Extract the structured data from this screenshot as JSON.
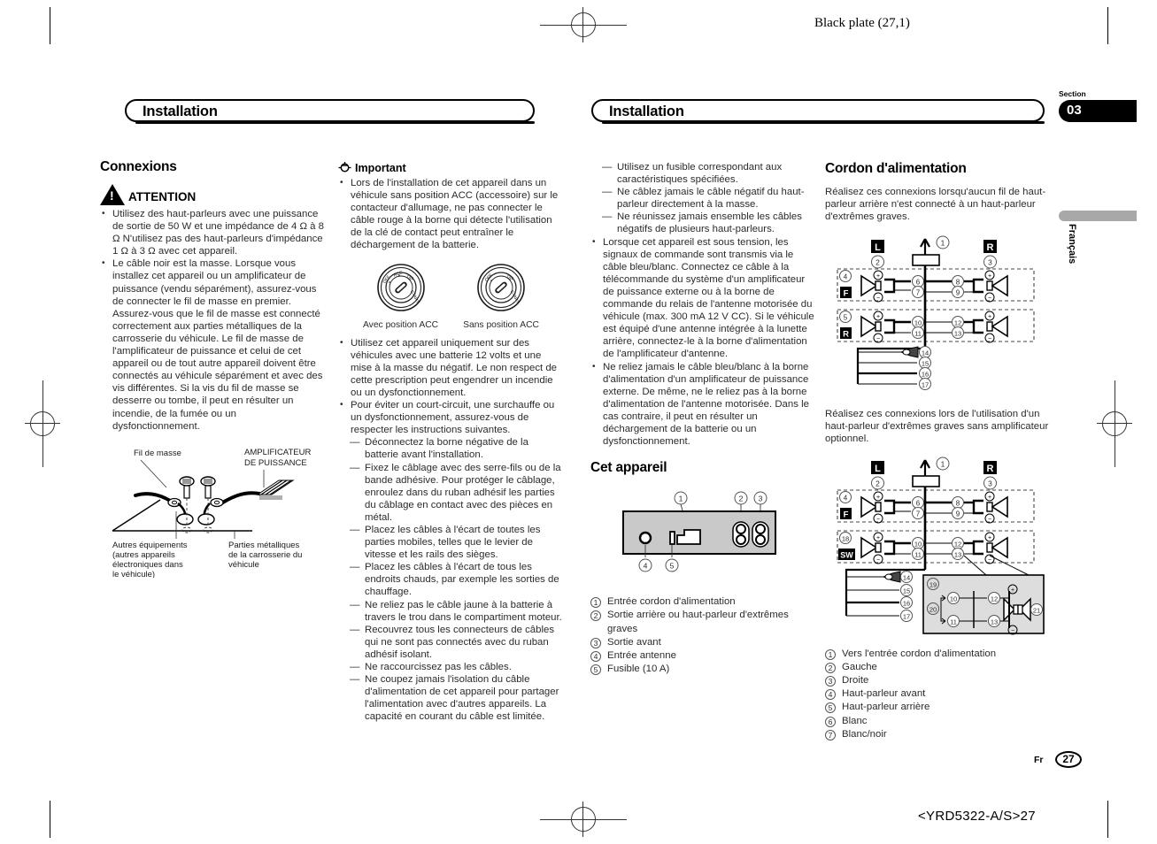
{
  "page": {
    "black_plate": "Black plate (27,1)",
    "section_label": "Section",
    "section_number": "03",
    "language_tab": "Français",
    "footer_lang": "Fr",
    "footer_page": "27",
    "footer_code": "<YRD5322-A/S>27"
  },
  "header": {
    "left_title": "Installation",
    "right_title": "Installation"
  },
  "col1": {
    "heading": "Connexions",
    "caution_word": "ATTENTION",
    "caution_items": [
      "Utilisez des haut-parleurs avec une puissance de sortie de 50 W et une impédance de 4 Ω à 8 Ω N'utilisez pas des haut-parleurs d'impédance 1 Ω à 3 Ω avec cet appareil.",
      "Le câble noir est la masse. Lorsque vous installez cet appareil ou un amplificateur de puissance (vendu séparément), assurez-vous de connecter le fil de masse en premier. Assurez-vous que le fil de masse est connecté correctement aux parties métalliques de la carrosserie du véhicule. Le fil de masse de l'amplificateur de puissance et celui de cet appareil ou de tout autre appareil doivent être connectés au véhicule séparément et avec des vis différentes. Si la vis du fil de masse se desserre ou tombe, il peut en résulter un incendie, de la fumée ou un dysfonctionnement."
    ],
    "figure_labels": {
      "ground_wire": "Fil de masse",
      "amplifier": "AMPLIFICATEUR DE PUISSANCE",
      "other_equipment": "Autres équipements (autres appareils électroniques dans le véhicule)",
      "metal_body": "Parties métalliques de la carrosserie du véhicule"
    }
  },
  "col2": {
    "important_word": "Important",
    "important_items": [
      "Lors de l'installation de cet appareil dans un véhicule sans position ACC (accessoire) sur le contacteur d'allumage, ne pas connecter le câble rouge à la borne qui détecte l'utilisation de la clé de contact peut entraîner le déchargement de la batterie."
    ],
    "key_figures": [
      {
        "caption": "Avec position ACC"
      },
      {
        "caption": "Sans position ACC"
      }
    ],
    "items": [
      "Utilisez cet appareil uniquement sur des véhicules avec une batterie 12 volts et une mise à la masse du négatif. Le non respect de cette prescription peut engendrer un incendie ou un dysfonctionnement.",
      "Pour éviter un court-circuit, une surchauffe ou un dysfonctionnement, assurez-vous de respecter les instructions suivantes."
    ],
    "sub_items": [
      "Déconnectez la borne négative de la batterie avant l'installation.",
      "Fixez le câblage avec des serre-fils ou de la bande adhésive. Pour protéger le câblage, enroulez dans du ruban adhésif les parties du câblage en contact avec des pièces en métal.",
      "Placez les câbles à l'écart de toutes les parties mobiles, telles que le levier de vitesse et les rails des sièges.",
      "Placez les câbles à l'écart de tous les endroits chauds, par exemple les sorties de chauffage.",
      "Ne reliez pas le câble jaune à la batterie à travers le trou dans le compartiment moteur.",
      "Recouvrez tous les connecteurs de câbles qui ne sont pas connectés avec du ruban adhésif isolant.",
      "Ne raccourcissez pas les câbles.",
      "Ne coupez jamais l'isolation du câble d'alimentation de cet appareil pour partager l'alimentation avec d'autres appareils. La capacité en courant du câble est limitée."
    ]
  },
  "col3": {
    "sub_items_top": [
      "Utilisez un fusible correspondant aux caractéristiques spécifiées.",
      "Ne câblez jamais le câble négatif du haut-parleur directement à la masse.",
      "Ne réunissez jamais ensemble les câbles négatifs de plusieurs haut-parleurs."
    ],
    "items": [
      "Lorsque cet appareil est sous tension, les signaux de commande sont transmis via le câble bleu/blanc. Connectez ce câble à la télécommande du système d'un amplificateur de puissance externe ou à la borne de commande du relais de l'antenne motorisée du véhicule (max. 300 mA 12 V CC). Si le véhicule est équipé d'une antenne intégrée à la lunette arrière, connectez-le à la borne d'alimentation de l'amplificateur d'antenne.",
      "Ne reliez jamais le câble bleu/blanc à la borne d'alimentation d'un amplificateur de puissance externe. De même, ne le reliez pas à la borne d'alimentation de l'antenne motorisée. Dans le cas contraire, il peut en résulter un déchargement de la batterie ou un dysfonctionnement."
    ],
    "unit_heading": "Cet appareil",
    "unit_callouts": [
      "1",
      "2",
      "3",
      "4",
      "5"
    ],
    "legend": [
      "Entrée cordon d'alimentation",
      "Sortie arrière ou haut-parleur d'extrêmes graves",
      "Sortie avant",
      "Entrée antenne",
      "Fusible (10 A)"
    ]
  },
  "col4": {
    "heading": "Cordon d'alimentation",
    "note1": "Réalisez ces connexions lorsqu'aucun fil de haut-parleur arrière n'est connecté à un haut-parleur d'extrêmes graves.",
    "note2": "Réalisez ces connexions lors de l'utilisation d'un haut-parleur d'extrêmes graves sans amplificateur optionnel.",
    "diagram1": {
      "left_label": "L",
      "right_label": "R",
      "left_num": "2",
      "right_num": "3",
      "top_num": "1",
      "row1": {
        "box_num": "4",
        "box_letter": "F",
        "left_plus": "+",
        "left_minus": "−",
        "n1": "6",
        "n2": "7",
        "n3": "8",
        "n4": "9",
        "right_plus": "+",
        "right_minus": "−"
      },
      "row2": {
        "box_num": "5",
        "box_letter": "R",
        "left_plus": "+",
        "left_minus": "−",
        "n1": "10",
        "n2": "11",
        "n3": "12",
        "n4": "13",
        "right_plus": "+",
        "right_minus": "−"
      },
      "wires": [
        "14",
        "15",
        "16",
        "17"
      ]
    },
    "diagram2": {
      "left_label": "L",
      "right_label": "R",
      "left_num": "2",
      "right_num": "3",
      "top_num": "1",
      "row1": {
        "box_num": "4",
        "box_letter": "F",
        "left_plus": "+",
        "left_minus": "−",
        "n1": "6",
        "n2": "7",
        "n3": "8",
        "n4": "9",
        "right_plus": "+",
        "right_minus": "−"
      },
      "row2": {
        "box_num": "18",
        "box_letter": "SW",
        "left_plus": "+",
        "left_minus": "−",
        "n1": "10",
        "n2": "11",
        "n3": "12",
        "n4": "13",
        "right_plus": "+",
        "right_minus": "−"
      },
      "wires": [
        "14",
        "15",
        "16",
        "17"
      ],
      "inset": {
        "box_num": "19",
        "brace_num": "20",
        "n1": "10",
        "n2": "11",
        "n3": "12",
        "n4": "13",
        "plus": "+",
        "minus": "−",
        "sp_num": "21"
      }
    },
    "legend": [
      "Vers l'entrée cordon d'alimentation",
      "Gauche",
      "Droite",
      "Haut-parleur avant",
      "Haut-parleur arrière",
      "Blanc",
      "Blanc/noir"
    ]
  }
}
